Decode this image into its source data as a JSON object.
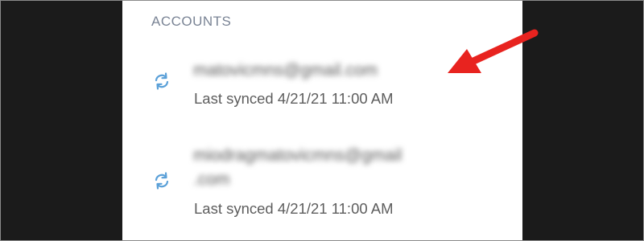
{
  "section": {
    "title": "ACCOUNTS"
  },
  "accounts": [
    {
      "email": "matovicmns@gmail.com",
      "status": "Last synced 4/21/21 11:00 AM",
      "icon": "sync-icon"
    },
    {
      "email_line1": "miodragmatovicmns@gmail",
      "email_line2": ".com",
      "status": "Last synced 4/21/21 11:00 AM",
      "icon": "sync-icon"
    }
  ],
  "colors": {
    "background": "#1b1b1b",
    "panel": "#ffffff",
    "header_text": "#7a8495",
    "sync_icon": "#5aa0d8",
    "annotation_arrow": "#e8231f"
  }
}
